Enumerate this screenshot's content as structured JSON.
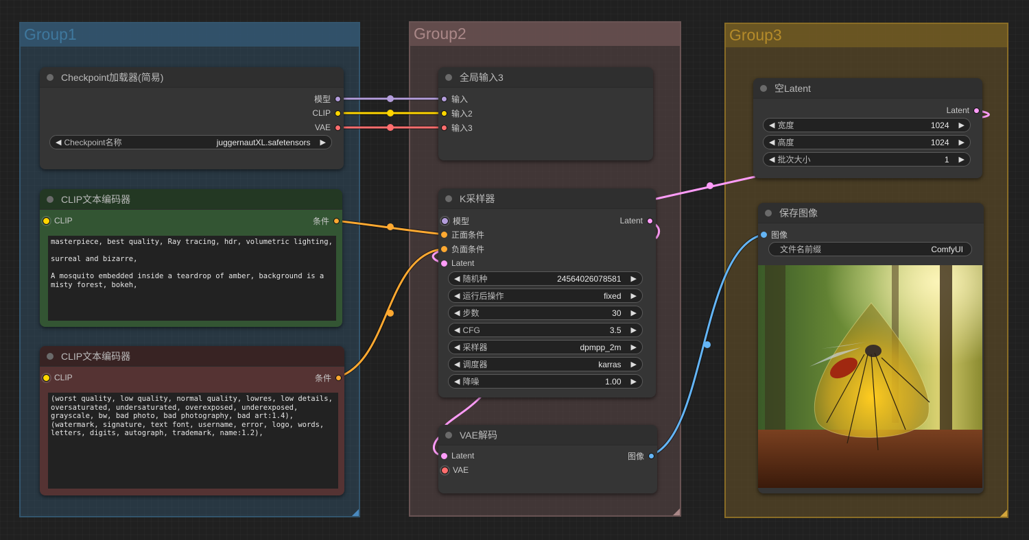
{
  "groups": [
    {
      "title": "Group1",
      "color": "#3f789e"
    },
    {
      "title": "Group2",
      "color": "#a88"
    },
    {
      "title": "Group3",
      "color": "#b58b2a"
    }
  ],
  "slot_colors": {
    "model": "#b39ddb",
    "clip": "#ffd500",
    "vae": "#ff6e6e",
    "conditioning": "#ffa931",
    "latent": "#ff9cf9",
    "image": "#64b5f6"
  },
  "checkpoint_loader": {
    "title": "Checkpoint加载器(简易)",
    "outputs": [
      "模型",
      "CLIP",
      "VAE"
    ],
    "widget": {
      "label": "Checkpoint名称",
      "value": "juggernautXL.safetensors"
    }
  },
  "clip_positive": {
    "title": "CLIP文本编码器",
    "input": "CLIP",
    "output": "条件",
    "text": "masterpiece, best quality, Ray tracing, hdr, volumetric lighting,\n\nsurreal and bizarre,\n\nA mosquito embedded inside a teardrop of amber, background is a\nmisty forest, bokeh,"
  },
  "clip_negative": {
    "title": "CLIP文本编码器",
    "input": "CLIP",
    "output": "条件",
    "text": "(worst quality, low quality, normal quality, lowres, low details,\noversaturated, undersaturated, overexposed, underexposed,\ngrayscale, bw, bad photo, bad photography, bad art:1.4),\n(watermark, signature, text font, username, error, logo, words,\nletters, digits, autograph, trademark, name:1.2),"
  },
  "global_input": {
    "title": "全局输入3",
    "inputs": [
      "输入",
      "输入2",
      "输入3"
    ]
  },
  "ksampler": {
    "title": "K采样器",
    "inputs": [
      "模型",
      "正面条件",
      "负面条件",
      "Latent"
    ],
    "output": "Latent",
    "widgets": [
      {
        "label": "随机种",
        "value": "24564026078581"
      },
      {
        "label": "运行后操作",
        "value": "fixed"
      },
      {
        "label": "步数",
        "value": "30"
      },
      {
        "label": "CFG",
        "value": "3.5"
      },
      {
        "label": "采样器",
        "value": "dpmpp_2m"
      },
      {
        "label": "调度器",
        "value": "karras"
      },
      {
        "label": "降噪",
        "value": "1.00"
      }
    ]
  },
  "vae_decode": {
    "title": "VAE解码",
    "inputs": [
      "Latent",
      "VAE"
    ],
    "output": "图像"
  },
  "empty_latent": {
    "title": "空Latent",
    "output": "Latent",
    "widgets": [
      {
        "label": "宽度",
        "value": "1024"
      },
      {
        "label": "高度",
        "value": "1024"
      },
      {
        "label": "批次大小",
        "value": "1"
      }
    ]
  },
  "save_image": {
    "title": "保存图像",
    "input": "图像",
    "widget": {
      "label": "文件名前缀",
      "value": "ComfyUI"
    },
    "preview_alt": "amber teardrop with mosquito in misty forest"
  }
}
